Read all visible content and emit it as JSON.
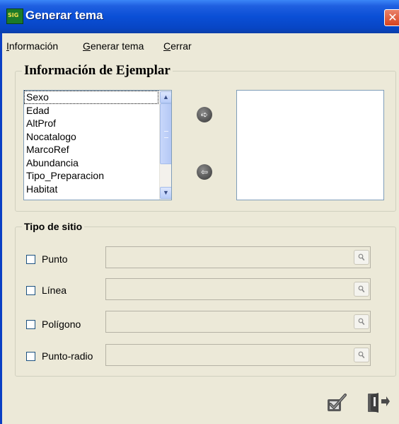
{
  "window": {
    "title": "Generar tema",
    "app_icon": "SIG",
    "close_glyph": "✕"
  },
  "menu": {
    "items": [
      {
        "first": "I",
        "rest": "nformación"
      },
      {
        "first": "G",
        "rest": "enerar tema"
      },
      {
        "first": "C",
        "rest": "errar"
      }
    ]
  },
  "ejemplar": {
    "title": "Información de Ejemplar",
    "fields": [
      "Sexo",
      "Edad",
      "AltProf",
      "Nocatalogo",
      "MarcoRef",
      "Abundancia",
      "Tipo_Preparacion",
      "Habitat"
    ],
    "add_glyph": "➪",
    "remove_glyph": "⇦"
  },
  "sitio": {
    "title": "Tipo de sitio",
    "options": [
      {
        "label": "Punto",
        "checked": false
      },
      {
        "label": "Línea",
        "checked": false
      },
      {
        "label": "Polígono",
        "checked": false
      },
      {
        "label": "Punto-radio",
        "checked": false
      }
    ]
  },
  "icons": {
    "accept": "check-icon",
    "exit": "exit-door-icon",
    "search": "magnifier-icon"
  }
}
